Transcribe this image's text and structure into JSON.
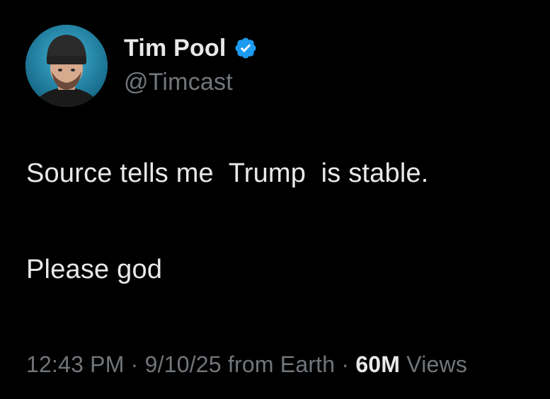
{
  "author": {
    "display_name": "Tim Pool",
    "handle": "@Timcast",
    "verified_icon": "verified-badge-icon",
    "verified_color": "#1d9bf0"
  },
  "tweet": {
    "line1": "Source tells me  Trump  is stable.",
    "line2": "Please god"
  },
  "meta": {
    "time": "12:43 PM",
    "separator1": " · ",
    "date": "9/10/25",
    "location": " from Earth",
    "separator2": " · ",
    "views_count": "60M",
    "views_label": " Views"
  },
  "colors": {
    "background": "#000000",
    "primary_text": "#e7e9ea",
    "secondary_text": "#71767b",
    "accent": "#1d9bf0"
  }
}
